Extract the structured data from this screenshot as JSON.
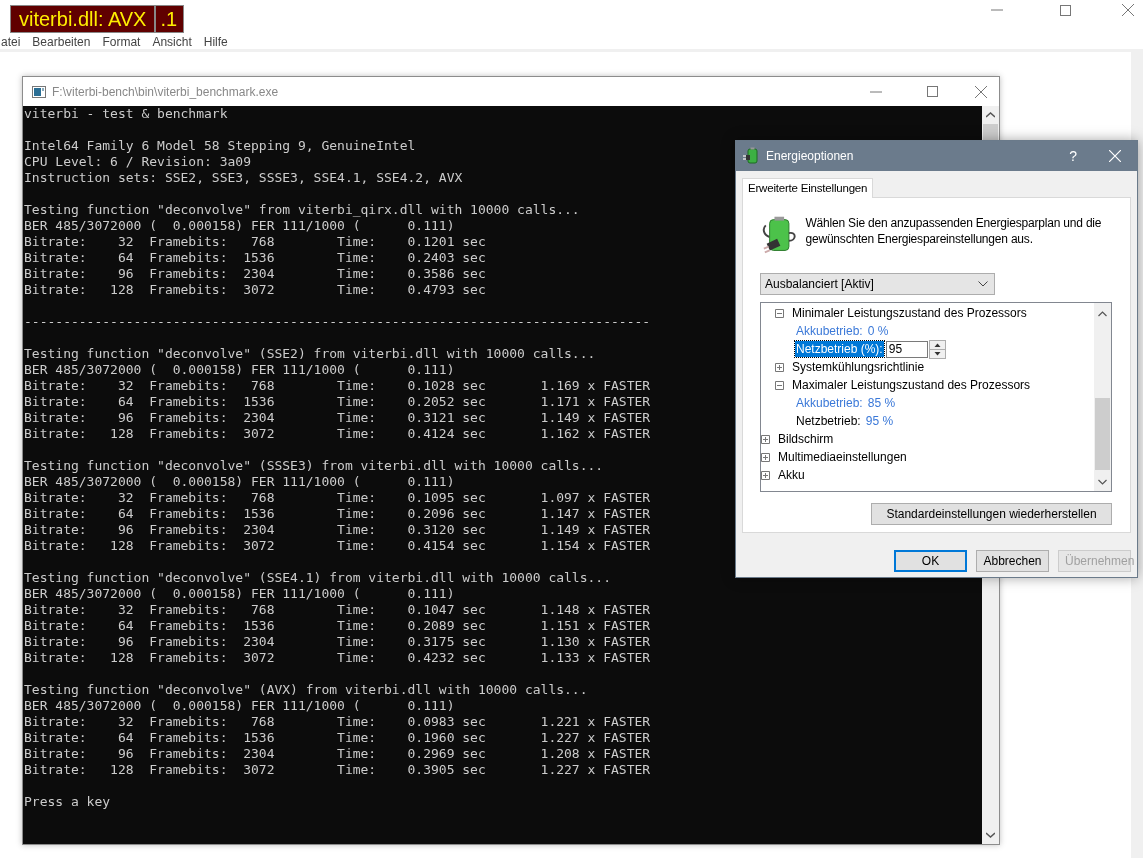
{
  "background_window": {
    "title_labels": [
      {
        "text": "viterbi.dll: AVX"
      },
      {
        "text": ".1"
      }
    ],
    "menu": [
      "atei",
      "Bearbeiten",
      "Format",
      "Ansicht",
      "Hilfe"
    ]
  },
  "console": {
    "title": "F:\\viterbi-bench\\bin\\viterbi_benchmark.exe",
    "blocks": [
      {
        "lines": [
          "viterbi - test & benchmark"
        ]
      },
      {
        "lines": [
          "Intel64 Family 6 Model 58 Stepping 9, GenuineIntel",
          "CPU Level: 6 / Revision: 3a09",
          "Instruction sets: SSE2, SSE3, SSSE3, SSE4.1, SSE4.2, AVX"
        ]
      },
      {
        "lines": [
          "Testing function \"deconvolve\" from viterbi_qirx.dll with 10000 calls...",
          "BER 485/3072000 (  0.000158) FER 111/1000 (      0.111)",
          "Bitrate:    32  Framebits:   768        Time:    0.1201 sec",
          "Bitrate:    64  Framebits:  1536        Time:    0.2403 sec",
          "Bitrate:    96  Framebits:  2304        Time:    0.3586 sec",
          "Bitrate:   128  Framebits:  3072        Time:    0.4793 sec"
        ]
      },
      {
        "lines": [
          "--------------------------------------------------------------------------------"
        ]
      },
      {
        "lines": [
          "Testing function \"deconvolve\" (SSE2) from viterbi.dll with 10000 calls...",
          "BER 485/3072000 (  0.000158) FER 111/1000 (      0.111)",
          "Bitrate:    32  Framebits:   768        Time:    0.1028 sec       1.169 x FASTER",
          "Bitrate:    64  Framebits:  1536        Time:    0.2052 sec       1.171 x FASTER",
          "Bitrate:    96  Framebits:  2304        Time:    0.3121 sec       1.149 x FASTER",
          "Bitrate:   128  Framebits:  3072        Time:    0.4124 sec       1.162 x FASTER"
        ]
      },
      {
        "lines": [
          "Testing function \"deconvolve\" (SSSE3) from viterbi.dll with 10000 calls...",
          "BER 485/3072000 (  0.000158) FER 111/1000 (      0.111)",
          "Bitrate:    32  Framebits:   768        Time:    0.1095 sec       1.097 x FASTER",
          "Bitrate:    64  Framebits:  1536        Time:    0.2096 sec       1.147 x FASTER",
          "Bitrate:    96  Framebits:  2304        Time:    0.3120 sec       1.149 x FASTER",
          "Bitrate:   128  Framebits:  3072        Time:    0.4154 sec       1.154 x FASTER"
        ]
      },
      {
        "lines": [
          "Testing function \"deconvolve\" (SSE4.1) from viterbi.dll with 10000 calls...",
          "BER 485/3072000 (  0.000158) FER 111/1000 (      0.111)",
          "Bitrate:    32  Framebits:   768        Time:    0.1047 sec       1.148 x FASTER",
          "Bitrate:    64  Framebits:  1536        Time:    0.2089 sec       1.151 x FASTER",
          "Bitrate:    96  Framebits:  2304        Time:    0.3175 sec       1.130 x FASTER",
          "Bitrate:   128  Framebits:  3072        Time:    0.4232 sec       1.133 x FASTER"
        ]
      },
      {
        "lines": [
          "Testing function \"deconvolve\" (AVX) from viterbi.dll with 10000 calls...",
          "BER 485/3072000 (  0.000158) FER 111/1000 (      0.111)",
          "Bitrate:    32  Framebits:   768        Time:    0.0983 sec       1.221 x FASTER",
          "Bitrate:    64  Framebits:  1536        Time:    0.1960 sec       1.227 x FASTER",
          "Bitrate:    96  Framebits:  2304        Time:    0.2969 sec       1.208 x FASTER",
          "Bitrate:   128  Framebits:  3072        Time:    0.3905 sec       1.227 x FASTER"
        ]
      },
      {
        "lines": [
          "Press a key"
        ]
      }
    ]
  },
  "dialog": {
    "title": "Energieoptionen",
    "help": "?",
    "tabs": [
      {
        "label": "Erweiterte Einstellungen",
        "selected": true
      }
    ],
    "description": "Wählen Sie den anzupassenden Energiesparplan und die gewünschten Energiespareinstellungen aus.",
    "plan": "Ausbalanciert [Aktiv]",
    "tree": [
      {
        "children": [
          {
            "kind": "group",
            "label": "Minimaler Leistungszustand des Prozessors",
            "expanded": true,
            "children": [
              {
                "kind": "value",
                "label": "Akkubetrieb:",
                "value": "0 %",
                "highlighted": true
              },
              {
                "kind": "edit",
                "label": "Netzbetrieb (%):",
                "value": "95",
                "selected": true
              }
            ]
          },
          {
            "kind": "group",
            "label": "Systemkühlungsrichtlinie",
            "expanded": false
          },
          {
            "kind": "group",
            "label": "Maximaler Leistungszustand des Prozessors",
            "expanded": true,
            "children": [
              {
                "kind": "value",
                "label": "Akkubetrieb:",
                "value": "85 %",
                "highlighted": true
              },
              {
                "kind": "value",
                "label": "Netzbetrieb:",
                "value": "95 %",
                "highlighted": false
              }
            ]
          }
        ]
      },
      {
        "kind": "group",
        "label": "Bildschirm",
        "expanded": false
      },
      {
        "kind": "group",
        "label": "Multimediaeinstellungen",
        "expanded": false
      },
      {
        "kind": "group",
        "label": "Akku",
        "expanded": false
      }
    ],
    "restore_button": "Standardeinstellungen wiederherstellen",
    "buttons": [
      {
        "label": "OK",
        "default": true,
        "disabled": false
      },
      {
        "label": "Abbrechen",
        "default": false,
        "disabled": false
      },
      {
        "label": "Übernehmen",
        "default": false,
        "disabled": true
      }
    ]
  }
}
